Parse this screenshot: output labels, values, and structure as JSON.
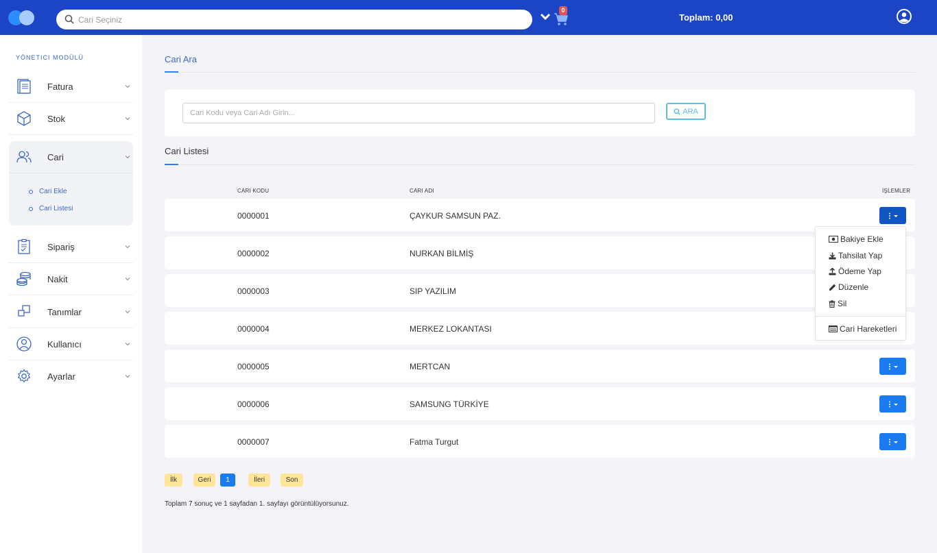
{
  "header": {
    "search_placeholder": "Cari Seçiniz",
    "cart_count": "0",
    "total": "Toplam: 0,00"
  },
  "sidebar": {
    "module_title": "YÖNETICI MODÜLÜ",
    "items": [
      {
        "label": "Fatura",
        "icon": "invoice-icon"
      },
      {
        "label": "Stok",
        "icon": "box-icon"
      },
      {
        "label": "Cari",
        "icon": "users-icon"
      },
      {
        "label": "Sipariş",
        "icon": "clipboard-icon"
      },
      {
        "label": "Nakit",
        "icon": "coins-icon"
      },
      {
        "label": "Tanımlar",
        "icon": "squares-icon"
      },
      {
        "label": "Kullanıcı",
        "icon": "user-circle-icon"
      },
      {
        "label": "Ayarlar",
        "icon": "gear-icon"
      }
    ],
    "cari_sub": [
      "Cari Ekle",
      "Cari Listesi"
    ]
  },
  "search_section": {
    "title": "Cari Ara",
    "placeholder": "Cari Kodu veya Cari Adı Girin...",
    "button": "ARA"
  },
  "list_section": {
    "title": "Cari Listesi",
    "columns": [
      "CARI KODU",
      "CARI ADI",
      "İŞLEMLER"
    ],
    "rows": [
      {
        "code": "0000001",
        "name": "ÇAYKUR SAMSUN PAZ."
      },
      {
        "code": "0000002",
        "name": "NURKAN BİLMİŞ"
      },
      {
        "code": "0000003",
        "name": "SIP YAZILIM"
      },
      {
        "code": "0000004",
        "name": "MERKEZ LOKANTASI"
      },
      {
        "code": "0000005",
        "name": "MERTCAN"
      },
      {
        "code": "0000006",
        "name": "SAMSUNG TÜRKİYE"
      },
      {
        "code": "0000007",
        "name": "Fatma Turgut"
      }
    ]
  },
  "dropdown": {
    "items": [
      "Bakiye Ekle",
      "Tahsilat Yap",
      "Ödeme Yap",
      "Düzenle",
      "Sil"
    ],
    "footer_item": "Cari Hareketleri"
  },
  "pagination": {
    "first": "İlk",
    "prev": "Geri",
    "current": "1",
    "next": "İleri",
    "last": "Son",
    "summary": "Toplam 7 sonuç ve 1 sayfadan 1. sayfayı görüntülüyorsunuz."
  },
  "colors": {
    "topbar": "#1b45c4",
    "accent": "#1a7bf0",
    "page_button": "#ffe599"
  }
}
